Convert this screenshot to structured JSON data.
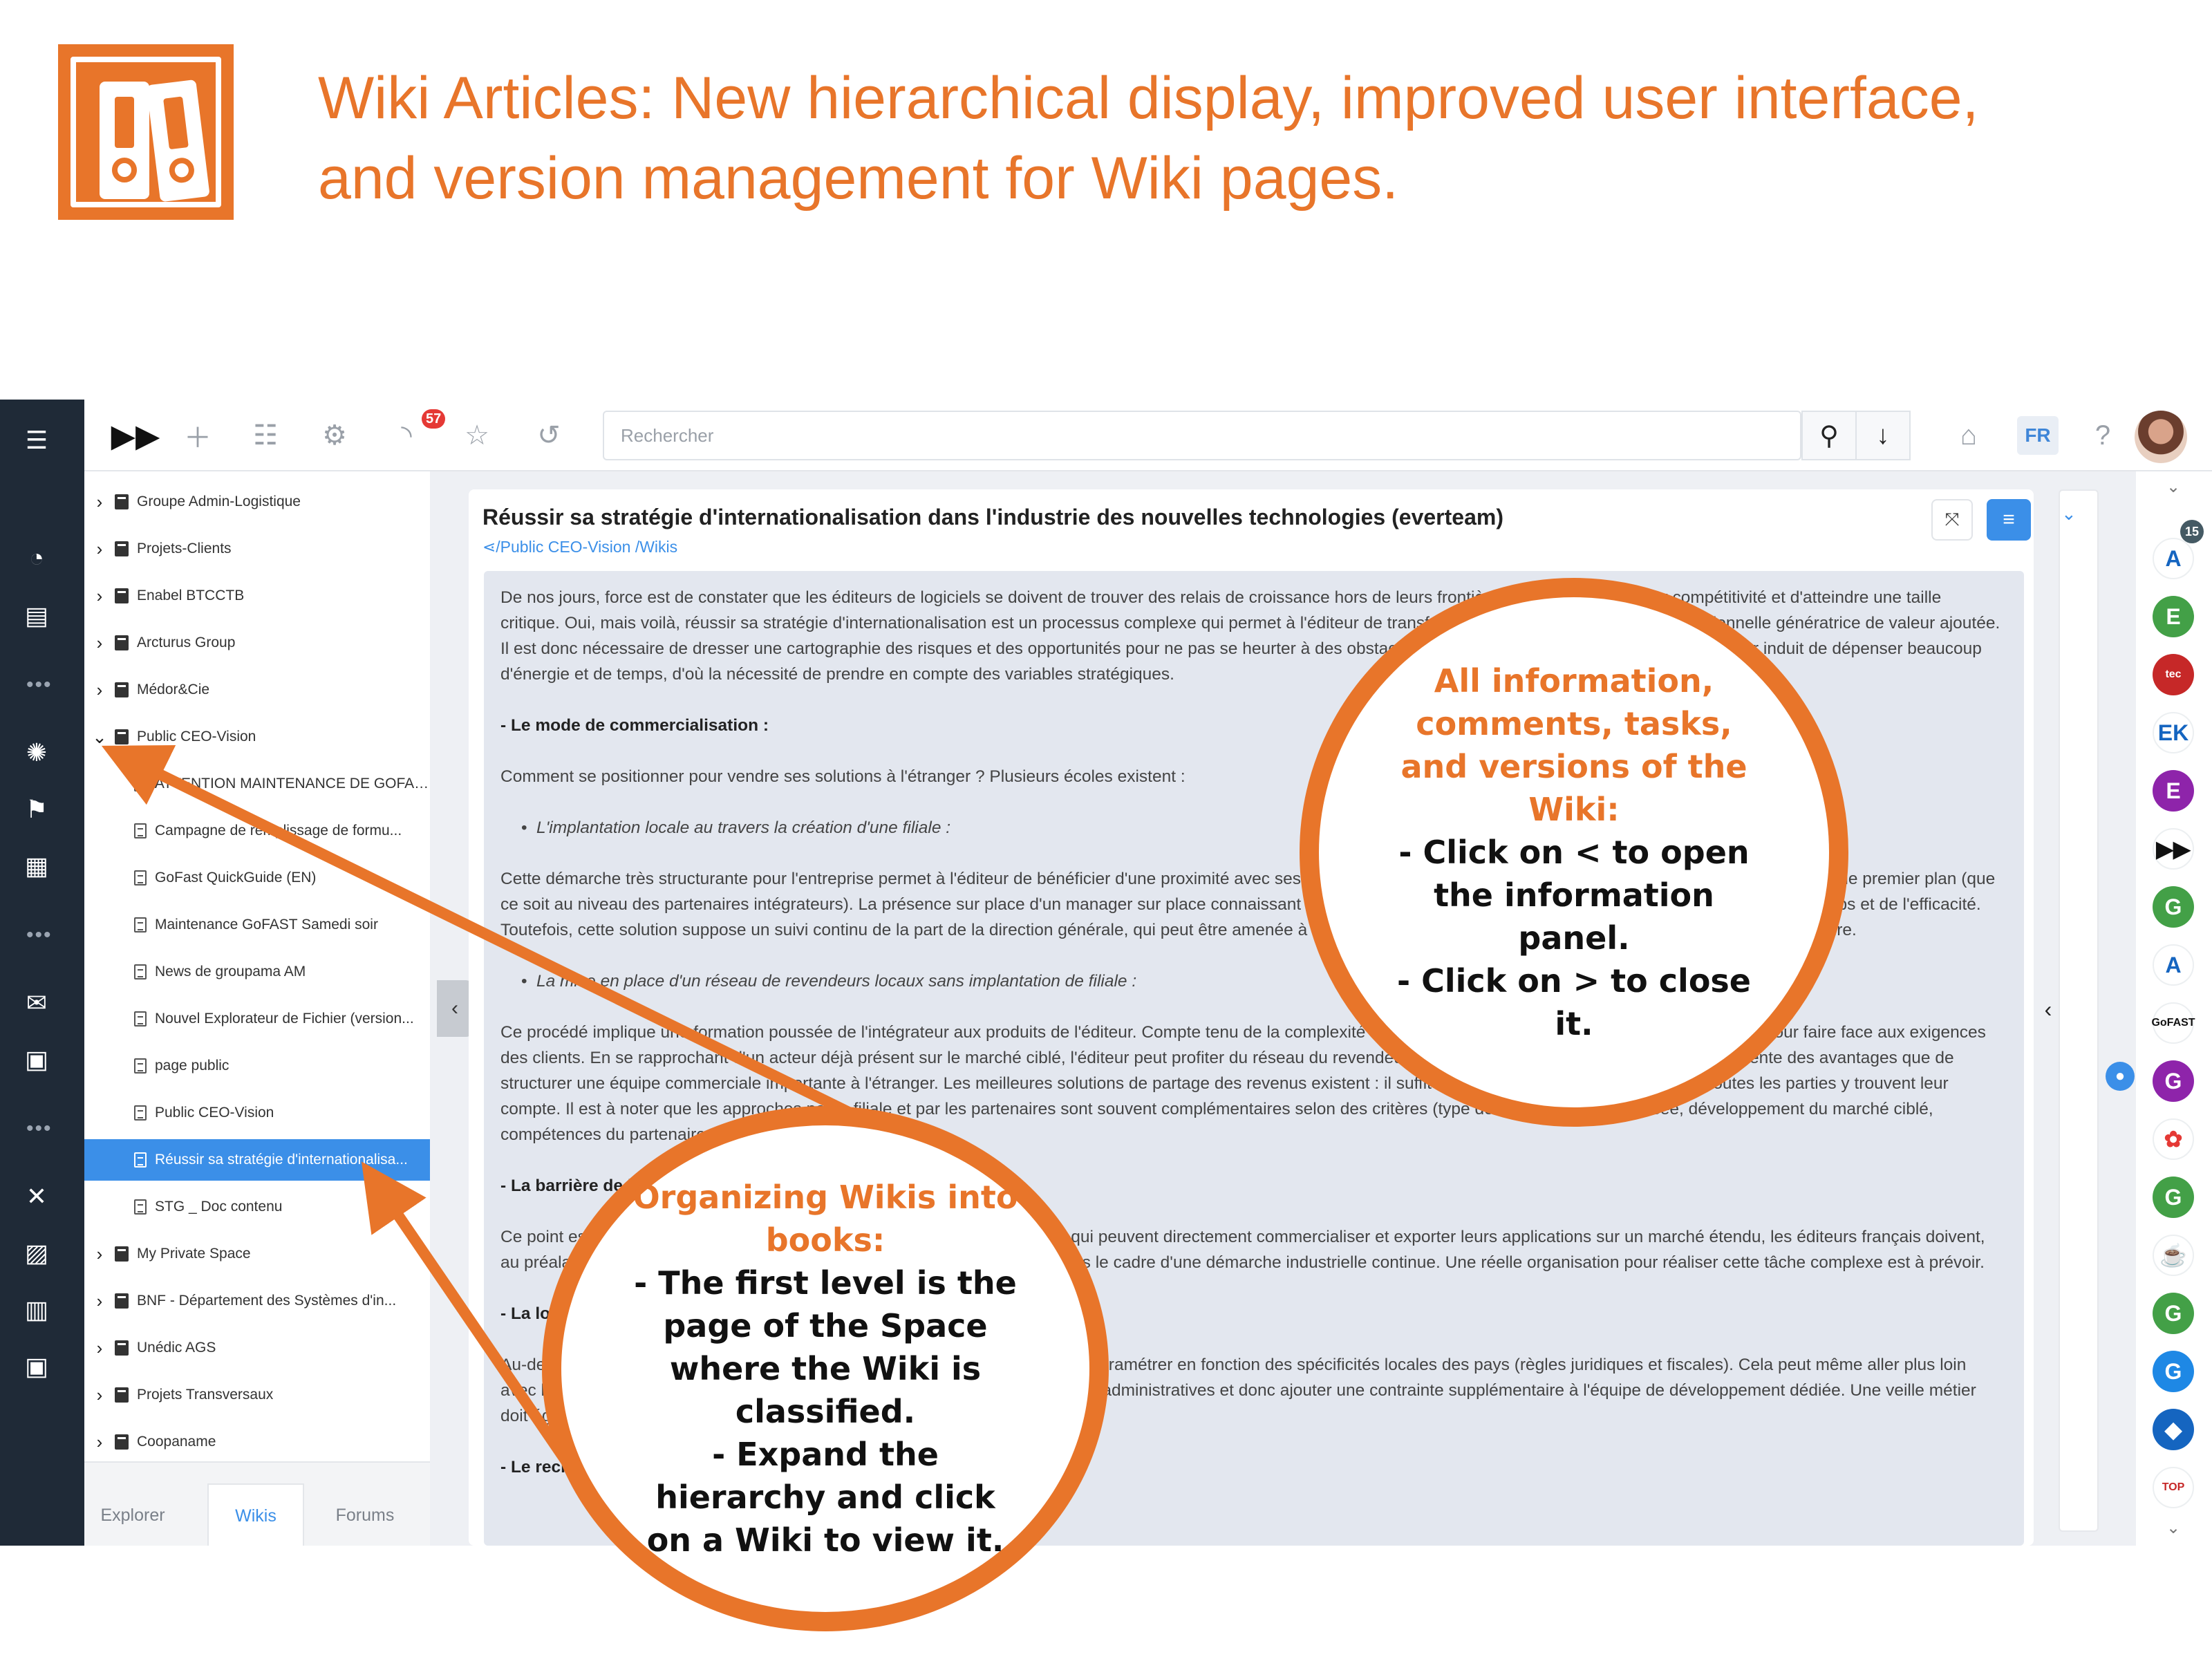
{
  "banner": {
    "headline_line1": "Wiki Articles: New hierarchical display, improved user interface,",
    "headline_line2": "and version management for Wiki pages.",
    "logo_icon": "binders-icon",
    "accent_color": "#e8752a"
  },
  "topbar": {
    "notifications_count": "57",
    "search_placeholder": "Rechercher",
    "language": "FR",
    "icons": [
      "fast-forward-icon",
      "plus-icon",
      "tree-icon",
      "gears-icon",
      "rss-icon",
      "star-icon",
      "history-icon",
      "search-icon",
      "download-icon",
      "basket-icon",
      "help-icon"
    ]
  },
  "tree": {
    "items": [
      {
        "label": "Groupe Admin-Logistique",
        "level": 1
      },
      {
        "label": "Projets-Clients",
        "level": 1
      },
      {
        "label": "Enabel BTCCTB",
        "level": 1
      },
      {
        "label": "Arcturus Group",
        "level": 1
      },
      {
        "label": "Médor&Cie",
        "level": 1
      },
      {
        "label": "Public CEO-Vision",
        "level": 1,
        "expanded": true
      },
      {
        "label": "ATTENTION MAINTENANCE DE GOFAST",
        "level": 2
      },
      {
        "label": "Campagne de remplissage de formu...",
        "level": 2
      },
      {
        "label": "GoFast QuickGuide (EN)",
        "level": 2
      },
      {
        "label": "Maintenance GoFAST Samedi soir",
        "level": 2
      },
      {
        "label": "News de groupama AM",
        "level": 2
      },
      {
        "label": "Nouvel Explorateur de Fichier (version...",
        "level": 2
      },
      {
        "label": "page public",
        "level": 2
      },
      {
        "label": "Public CEO-Vision",
        "level": 2
      },
      {
        "label": "Réussir sa stratégie d'internationalisa...",
        "level": 2,
        "active": true
      },
      {
        "label": "STG _ Doc contenu",
        "level": 2
      },
      {
        "label": "My Private Space",
        "level": 1
      },
      {
        "label": "BNF - Département des Systèmes d'in...",
        "level": 1
      },
      {
        "label": "Unédic AGS",
        "level": 1
      },
      {
        "label": "Projets Transversaux",
        "level": 1
      },
      {
        "label": "Coopaname",
        "level": 1
      }
    ],
    "tabs": [
      "Explorer",
      "Wikis",
      "Forums"
    ],
    "active_tab": "Wikis"
  },
  "document": {
    "title": "Réussir sa stratégie d'internationalisation dans l'industrie des nouvelles technologies (everteam)",
    "breadcrumb_1": "Public CEO-Vision",
    "breadcrumb_2": "Wikis",
    "paragraphs": [
      "De nos jours, force est de constater que les éditeurs de logiciels se doivent de trouver des relais de croissance hors de leurs frontières pour développer leur compétitivité et d'atteindre une taille critique. Oui, mais voilà, réussir sa stratégie d'internationalisation est un processus complexe qui permet à l'éditeur de transformer son projet en une réalité opérationnelle génératrice de valeur ajoutée. Il est donc nécessaire de dresser une cartographie des risques et des opportunités pour ne pas se heurter à des obstacles divers et variés. Rappelons-nous qu'exporter induit de dépenser beaucoup d'énergie et de temps, d'où la nécessité de prendre en compte des variables stratégiques.",
      "- Le mode de commercialisation :",
      "Comment se positionner pour vendre ses solutions à l'étranger ? Plusieurs écoles existent :",
      "L'implantation locale au travers la création d'une filiale :",
      "Cette démarche très structurante pour l'entreprise permet à l'éditeur de bénéficier d'une proximité avec ses clients et d'avoir sur place une représentation et une qualité de service de premier plan (que ce soit au niveau des partenaires intégrateurs). La présence sur place d'un manager sur place connaissant le marché et son fonctionnement contribue également à gagner du temps et de l'efficacité. Toutefois, cette solution suppose un suivi continu de la part de la direction générale, qui peut être amenée à se déplacer fréquemment pour suivre l'évolution de la nouvelle structure.",
      "La mise en place d'un réseau de revendeurs locaux sans implantation de filiale :",
      "Ce procédé implique une formation poussée de l'intégrateur aux produits de l'éditeur. Compte tenu de la complexité des solutions, il doit maîtriser parfaitement son sujet pour faire face aux exigences des clients. En se rapprochant d'un acteur déjà présent sur le marché ciblé, l'éditeur peut profiter du réseau du revendeur et de ses forces commerciales, ce qui représente des avantages que de structurer une équipe commerciale importante à l'étranger. Les meilleures solutions de partage des revenus existent : il suffit de trouver le bon équilibre pour que toutes les parties y trouvent leur compte. Il est à noter que les approches par la filiale et par les partenaires sont souvent complémentaires selon des critères (type de solution commercialisée, développement du marché ciblé, compétences du partenaire...).",
      "- La barrière de la langue :",
      "Ce point est souvent sous-estimé, contrairement aux éditeurs anglo-saxons qui peuvent directement commercialiser et exporter leurs applications sur un marché étendu, les éditeurs français doivent, au préalable, traduire leurs logiciels. Ce travail stratégique doit être mené dans le cadre d'une démarche industrielle continue. Une réelle organisation pour réaliser cette tâche complexe est à prévoir.",
      "- La localisation des produits :",
      "Au-delà de la traduction des logiciels, il faut évidemment à les adapter et à les paramétrer en fonction des spécificités locales des pays (règles juridiques et fiscales). Cela peut même aller plus loin avec la création de fonctionnalités dédiées à certaines zones géographiques ou administratives et donc ajouter une contrainte supplémentaire à l'équipe de développement dédiée. Une veille métier doit également être entreprise en parallèle.",
      "- Le recrutement :"
    ]
  },
  "spaces": {
    "count": "15",
    "items": [
      {
        "letter": "A",
        "color": "#ffffff",
        "fg": "#1565c0"
      },
      {
        "letter": "E",
        "color": "#43a047",
        "fg": "#ffffff"
      },
      {
        "letter": "tec",
        "color": "#c62828",
        "fg": "#ffffff"
      },
      {
        "letter": "EK",
        "color": "#ffffff",
        "fg": "#1565c0"
      },
      {
        "letter": "E",
        "color": "#8e24aa",
        "fg": "#ffffff"
      },
      {
        "letter": "▶▶",
        "color": "#ffffff",
        "fg": "#111111"
      },
      {
        "letter": "G",
        "color": "#43a047",
        "fg": "#ffffff"
      },
      {
        "letter": "A",
        "color": "#ffffff",
        "fg": "#1565c0"
      },
      {
        "letter": "GoFAST",
        "color": "#ffffff",
        "fg": "#111111"
      },
      {
        "letter": "G",
        "color": "#8e24aa",
        "fg": "#ffffff"
      },
      {
        "letter": "✿",
        "color": "#ffffff",
        "fg": "#e53935"
      },
      {
        "letter": "G",
        "color": "#43a047",
        "fg": "#ffffff"
      },
      {
        "letter": "☕",
        "color": "#ffffff",
        "fg": "#f9a825"
      },
      {
        "letter": "G",
        "color": "#43a047",
        "fg": "#ffffff"
      },
      {
        "letter": "G",
        "color": "#1e88e5",
        "fg": "#ffffff"
      },
      {
        "letter": "◆",
        "color": "#1565c0",
        "fg": "#ffffff"
      },
      {
        "letter": "TOP",
        "color": "#ffffff",
        "fg": "#c62828"
      }
    ]
  },
  "callouts": {
    "right_title": "All information, comments, tasks, and versions of the Wiki:",
    "right_line1": "- Click on < to open the information panel.",
    "right_line2": "- Click on > to close it.",
    "left_title": "Organizing Wikis into books:",
    "left_line1": "- The first level is the page of the Space where the Wiki is classified.",
    "left_line2": "- Expand the hierarchy and click on a Wiki to view it."
  }
}
